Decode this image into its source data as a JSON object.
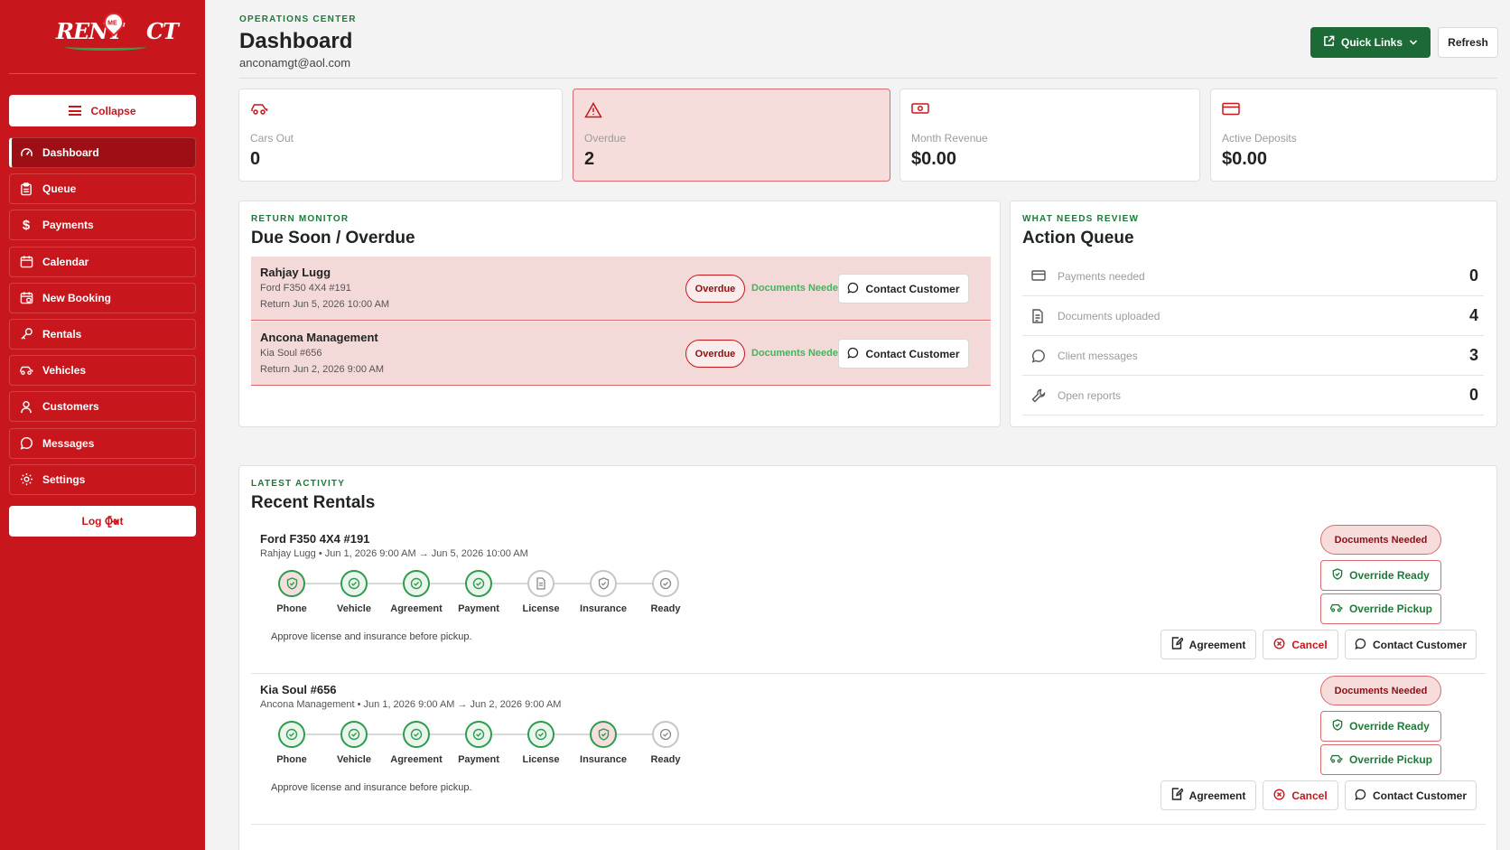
{
  "brand": {
    "logo_text": "RENT",
    "logo_badge": "ME",
    "logo_suffix": "CT"
  },
  "sidebar": {
    "collapse_label": "Collapse",
    "items": [
      {
        "label": "Dashboard",
        "icon": "gauge-icon",
        "active": true
      },
      {
        "label": "Queue",
        "icon": "clipboard-icon"
      },
      {
        "label": "Payments",
        "icon": "dollar-icon"
      },
      {
        "label": "Calendar",
        "icon": "calendar-icon"
      },
      {
        "label": "New Booking",
        "icon": "calendar-plus-icon"
      },
      {
        "label": "Rentals",
        "icon": "key-icon"
      },
      {
        "label": "Vehicles",
        "icon": "car-icon"
      },
      {
        "label": "Customers",
        "icon": "user-icon"
      },
      {
        "label": "Messages",
        "icon": "chat-icon"
      },
      {
        "label": "Settings",
        "icon": "gear-icon"
      }
    ],
    "logout_label": "Log Out"
  },
  "header": {
    "eyebrow": "OPERATIONS CENTER",
    "title": "Dashboard",
    "email": "anconamgt@aol.com",
    "quick_links_label": "Quick Links",
    "refresh_label": "Refresh"
  },
  "stats": [
    {
      "label": "Cars Out",
      "value": "0",
      "icon": "car-icon"
    },
    {
      "label": "Overdue",
      "value": "2",
      "icon": "warning-icon",
      "alert": true
    },
    {
      "label": "Month Revenue",
      "value": "$0.00",
      "icon": "cash-icon"
    },
    {
      "label": "Active Deposits",
      "value": "$0.00",
      "icon": "card-icon"
    }
  ],
  "return_monitor": {
    "eyebrow": "RETURN MONITOR",
    "title": "Due Soon / Overdue",
    "rows": [
      {
        "name": "Rahjay Lugg",
        "vehicle": "Ford F350 4X4 #191",
        "return": "Return Jun 5, 2026 10:00 AM",
        "status": "Overdue",
        "docs": "Documents Needed",
        "action": "Contact Customer"
      },
      {
        "name": "Ancona Management",
        "vehicle": "Kia Soul #656",
        "return": "Return Jun 2, 2026 9:00 AM",
        "status": "Overdue",
        "docs": "Documents Needed",
        "action": "Contact Customer"
      }
    ]
  },
  "action_queue": {
    "eyebrow": "WHAT NEEDS REVIEW",
    "title": "Action Queue",
    "rows": [
      {
        "label": "Payments needed",
        "count": "0",
        "icon": "card-icon"
      },
      {
        "label": "Documents uploaded",
        "count": "4",
        "icon": "document-icon"
      },
      {
        "label": "Client messages",
        "count": "3",
        "icon": "chat-icon"
      },
      {
        "label": "Open reports",
        "count": "0",
        "icon": "wrench-icon"
      }
    ]
  },
  "recent_rentals": {
    "eyebrow": "LATEST ACTIVITY",
    "title": "Recent Rentals",
    "step_labels": [
      "Phone",
      "Vehicle",
      "Agreement",
      "Payment",
      "License",
      "Insurance",
      "Ready"
    ],
    "items": [
      {
        "title": "Ford F350 4X4 #191",
        "subtitle": "Rahjay Lugg • Jun 1, 2026 9:00 AM → Jun 5, 2026 10:00 AM",
        "steps": [
          "warn",
          "done",
          "done",
          "done",
          "doc",
          "shield",
          "pending"
        ],
        "note": "Approve license and insurance before pickup.",
        "badge": "Documents Needed",
        "override_ready": "Override Ready",
        "override_pickup": "Override Pickup",
        "agreement": "Agreement",
        "cancel": "Cancel",
        "contact": "Contact Customer"
      },
      {
        "title": "Kia Soul #656",
        "subtitle": "Ancona Management • Jun 1, 2026 9:00 AM → Jun 2, 2026 9:00 AM",
        "steps": [
          "done",
          "done",
          "done",
          "done",
          "done",
          "warn",
          "pending"
        ],
        "note": "Approve license and insurance before pickup.",
        "badge": "Documents Needed",
        "override_ready": "Override Ready",
        "override_pickup": "Override Pickup",
        "agreement": "Agreement",
        "cancel": "Cancel",
        "contact": "Contact Customer"
      }
    ]
  },
  "colors": {
    "brand_red": "#c8161d",
    "accent_green": "#1c6b37",
    "alert_bg": "#f7dcdc"
  }
}
